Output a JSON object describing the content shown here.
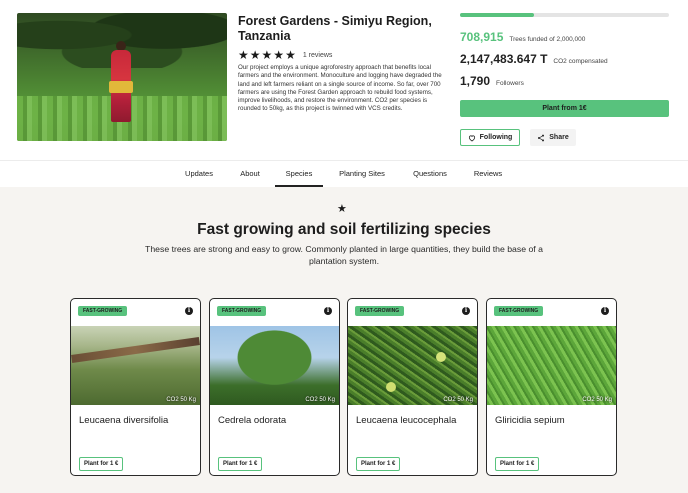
{
  "project": {
    "title": "Forest Gardens - Simiyu Region, Tanzania",
    "rating_stars": 5,
    "reviews_label": "1 reviews",
    "description": "Our project employs a unique agroforestry approach that benefits local farmers and the environment. Monoculture and logging have degraded the land and left farmers reliant on a single source of income. So far, over 700 farmers are using the Forest Garden approach to rebuild food systems, improve livelihoods, and restore the environment. CO2 per species is rounded to 50kg, as this project is twinned with VCS credits."
  },
  "stats": {
    "progress_fraction": 0.354,
    "trees_funded": "708,915",
    "trees_funded_label": "Trees funded of 2,000,000",
    "co2_value": "2,147,483.647 T",
    "co2_label": "CO2 compensated",
    "followers_value": "1,790",
    "followers_label": "Followers"
  },
  "actions": {
    "plant_label": "Plant from 1€",
    "follow_label": "Following",
    "share_label": "Share"
  },
  "tabs": [
    {
      "label": "Updates"
    },
    {
      "label": "About"
    },
    {
      "label": "Species",
      "active": true
    },
    {
      "label": "Planting Sites"
    },
    {
      "label": "Questions"
    },
    {
      "label": "Reviews"
    }
  ],
  "section": {
    "icon": "star-icon",
    "title": "Fast growing and soil fertilizing species",
    "subtitle": "These trees are strong and easy to grow. Commonly planted in large quantities, they build the base of a plantation system."
  },
  "species": [
    {
      "badge": "FAST-GROWING",
      "name": "Leucaena diversifolia",
      "co2": "CO2 50 Kg",
      "plant_label": "Plant for 1 €"
    },
    {
      "badge": "FAST-GROWING",
      "name": "Cedrela odorata",
      "co2": "CO2 50 Kg",
      "plant_label": "Plant for 1 €"
    },
    {
      "badge": "FAST-GROWING",
      "name": "Leucaena leucocephala",
      "co2": "CO2 50 Kg",
      "plant_label": "Plant for 1 €"
    },
    {
      "badge": "FAST-GROWING",
      "name": "Gliricidia sepium",
      "co2": "CO2 50 Kg",
      "plant_label": "Plant for 1 €"
    }
  ],
  "colors": {
    "accent": "#58c27d",
    "text": "#1d1d1d",
    "section_bg": "#f6f4f1"
  }
}
